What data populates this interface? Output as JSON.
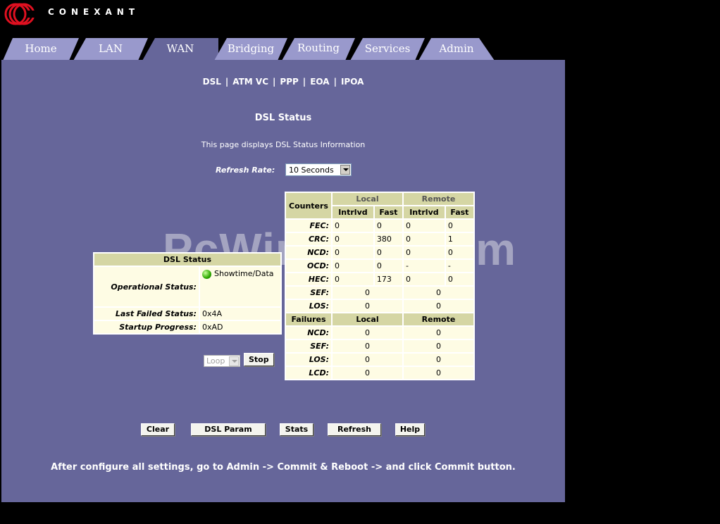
{
  "brand": {
    "name": "CONEXANT"
  },
  "tabs": [
    "Home",
    "LAN",
    "WAN",
    "Bridging",
    "Routing",
    "Services",
    "Admin"
  ],
  "active_tab": "WAN",
  "subnav": [
    "DSL",
    "ATM VC",
    "PPP",
    "EOA",
    "IPOA"
  ],
  "watermark": "PcWinTech.com",
  "page": {
    "title": "DSL Status",
    "description": "This page displays DSL Status Information",
    "refresh_label": "Refresh Rate:",
    "refresh_value": "10 Seconds"
  },
  "dsl_status": {
    "header": "DSL Status",
    "operational_label": "Operational Status:",
    "operational_value": "Showtime/Data",
    "loop_value": "Loop",
    "stop_label": "Stop",
    "last_failed_label": "Last Failed Status:",
    "last_failed_value": "0x4A",
    "startup_label": "Startup Progress:",
    "startup_value": "0xAD"
  },
  "counters": {
    "header": "Counters",
    "local": "Local",
    "remote": "Remote",
    "cols": [
      "Intrlvd",
      "Fast",
      "Intrlvd",
      "Fast"
    ],
    "rows": [
      {
        "label": "FEC:",
        "values": [
          "0",
          "0",
          "0",
          "0"
        ]
      },
      {
        "label": "CRC:",
        "values": [
          "0",
          "380",
          "0",
          "1"
        ]
      },
      {
        "label": "NCD:",
        "values": [
          "0",
          "0",
          "0",
          "0"
        ]
      },
      {
        "label": "OCD:",
        "values": [
          "0",
          "0",
          "-",
          "-"
        ]
      },
      {
        "label": "HEC:",
        "values": [
          "0",
          "173",
          "0",
          "0"
        ]
      }
    ],
    "merged_rows": [
      {
        "label": "SEF:",
        "values": [
          "0",
          "0"
        ]
      },
      {
        "label": "LOS:",
        "values": [
          "0",
          "0"
        ]
      }
    ]
  },
  "failures": {
    "header": "Failures",
    "local": "Local",
    "remote": "Remote",
    "rows": [
      {
        "label": "NCD:",
        "values": [
          "0",
          "0"
        ]
      },
      {
        "label": "SEF:",
        "values": [
          "0",
          "0"
        ]
      },
      {
        "label": "LOS:",
        "values": [
          "0",
          "0"
        ]
      },
      {
        "label": "LCD:",
        "values": [
          "0",
          "0"
        ]
      }
    ]
  },
  "buttons": [
    "Clear",
    "DSL Param",
    "Stats",
    "Refresh",
    "Help"
  ],
  "note": "After configure all settings, go to Admin -> Commit & Reboot -> and click Commit button.",
  "colors": {
    "panel": "#66669a",
    "tab": "#9999cc",
    "active_tab": "#66669a",
    "table_header": "#d5d6a4",
    "table_cell": "#fefce4"
  }
}
